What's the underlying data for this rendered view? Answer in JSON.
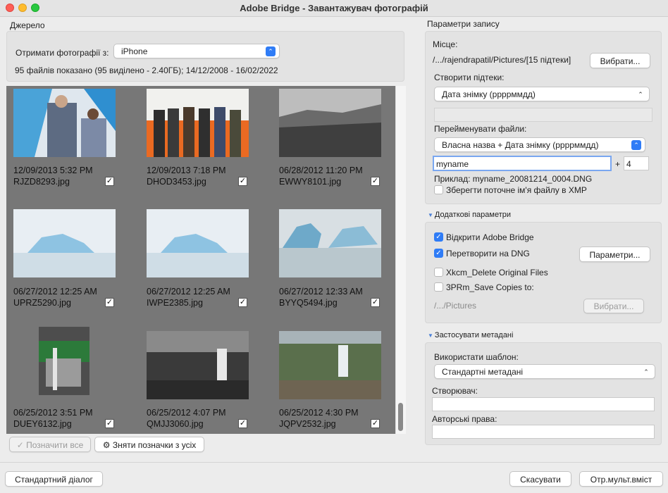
{
  "window": {
    "title": "Adobe Bridge - Завантажувач фотографій"
  },
  "source": {
    "section_label": "Джерело",
    "get_photos_label": "Отримати фотографії з:",
    "device": "iPhone",
    "summary": "95 файлів показано (95 виділено - 2.40ГБ); 14/12/2008 - 16/02/2022"
  },
  "photos": [
    {
      "date": "12/09/2013 5:32 PM",
      "name": "RJZD8293.jpg",
      "checked": "✓"
    },
    {
      "date": "12/09/2013 7:18 PM",
      "name": "DHOD3453.jpg",
      "checked": "✓"
    },
    {
      "date": "06/28/2012 11:20 PM",
      "name": "EWWY8101.jpg",
      "checked": "✓"
    },
    {
      "date": "06/27/2012 12:25 AM",
      "name": "UPRZ5290.jpg",
      "checked": "✓"
    },
    {
      "date": "06/27/2012 12:25 AM",
      "name": "IWPE2385.jpg",
      "checked": "✓"
    },
    {
      "date": "06/27/2012 12:33 AM",
      "name": "BYYQ5494.jpg",
      "checked": "✓"
    },
    {
      "date": "06/25/2012 3:51 PM",
      "name": "DUEY6132.jpg",
      "checked": "✓"
    },
    {
      "date": "06/25/2012 4:07 PM",
      "name": "QMJJ3060.jpg",
      "checked": "✓"
    },
    {
      "date": "06/25/2012 4:30 PM",
      "name": "JQPV2532.jpg",
      "checked": "✓"
    }
  ],
  "grid_buttons": {
    "check_all": "Позначити все",
    "uncheck_all": "Зняти позначки з усіх"
  },
  "save": {
    "section_label": "Параметри запису",
    "location_label": "Місце:",
    "location_path": "/.../rajendrapatil/Pictures/[15 підтеки]",
    "choose": "Вибрати...",
    "subfolders_label": "Створити підтеки:",
    "subfolders_value": "Дата знімку (ррррммдд)",
    "rename_label": "Перейменувати файли:",
    "rename_value": "Власна назва + Дата знімку (ррррммдд)",
    "custom_name": "myname",
    "plus": "+",
    "seq_number": "4",
    "example": "Приклад:  myname_20081214_0004.DNG",
    "preserve_label": "Зберегти поточне ім'я файлу в XMP"
  },
  "advanced": {
    "section_label": "Додаткові параметри",
    "open_bridge": "Відкрити Adobe Bridge",
    "convert_dng": "Перетворити на DNG",
    "params_button": "Параметри...",
    "delete_original": "Xkcm_Delete Original Files",
    "save_copies": "3PRm_Save Copies to:",
    "copies_path": "/.../Pictures",
    "choose_disabled": "Вибрати..."
  },
  "metadata": {
    "section_label": "Застосувати метадані",
    "template_label": "Використати шаблон:",
    "template_value": "Стандартні метадані",
    "creator_label": "Створювач:",
    "copyright_label": "Авторські права:"
  },
  "footer": {
    "standard_dialog": "Стандартний діалог",
    "cancel": "Скасувати",
    "get_media": "Отр.мульт.вміст"
  },
  "colors": {
    "accent": "#2f7cf6",
    "grid_bg": "#777777"
  }
}
